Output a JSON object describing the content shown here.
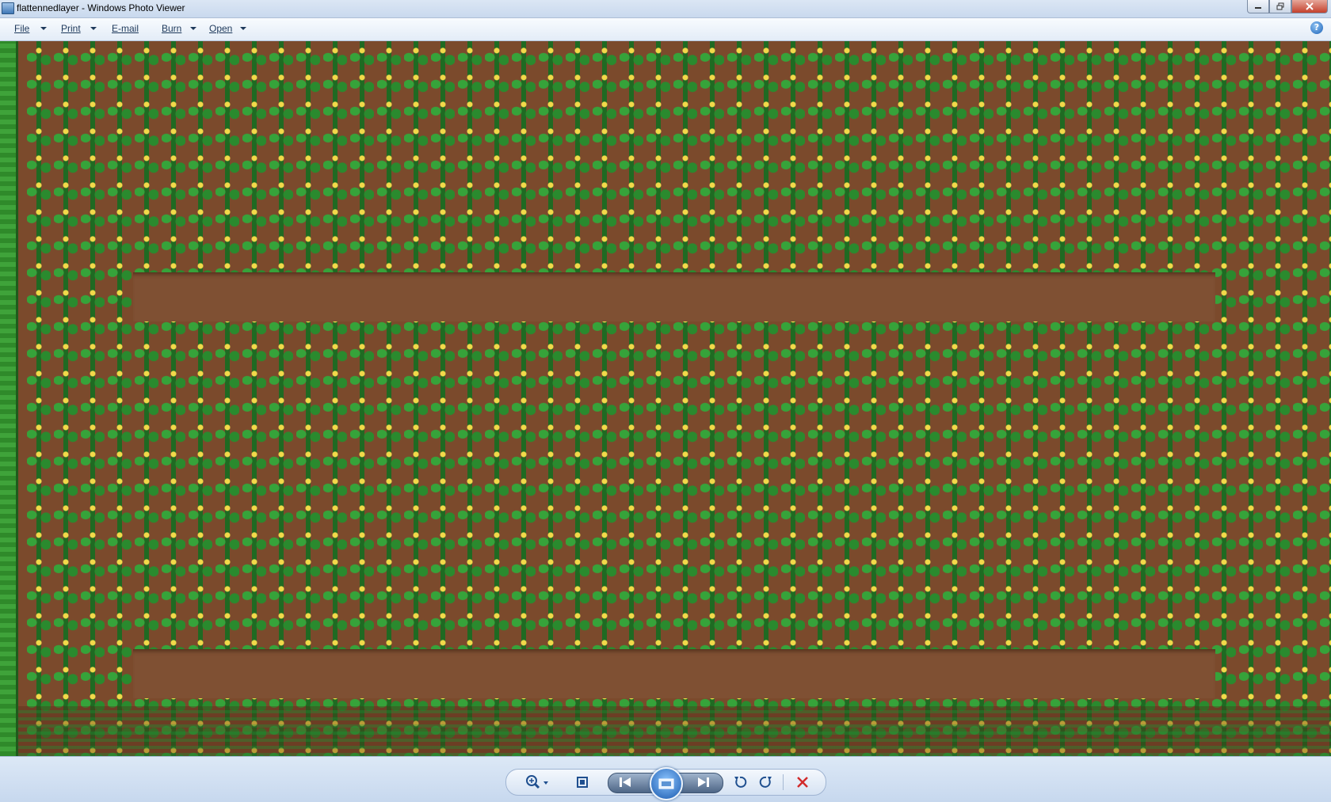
{
  "window": {
    "title": "flattennedlayer - Windows Photo Viewer"
  },
  "menu": {
    "file": "File",
    "print": "Print",
    "email": "E-mail",
    "burn": "Burn",
    "open": "Open"
  },
  "help": {
    "label": "?"
  },
  "image": {
    "description_icon": "cornfield-image",
    "colors": {
      "soil": "#7f5033",
      "leaf": "#2a8a2e",
      "tassel": "#f2d94a",
      "grass": "#3fa33a"
    }
  },
  "toolbar": {
    "icons": [
      "zoom-icon",
      "actual-size-icon",
      "previous-icon",
      "slideshow-icon",
      "next-icon",
      "rotate-left-icon",
      "rotate-right-icon",
      "delete-icon"
    ]
  }
}
